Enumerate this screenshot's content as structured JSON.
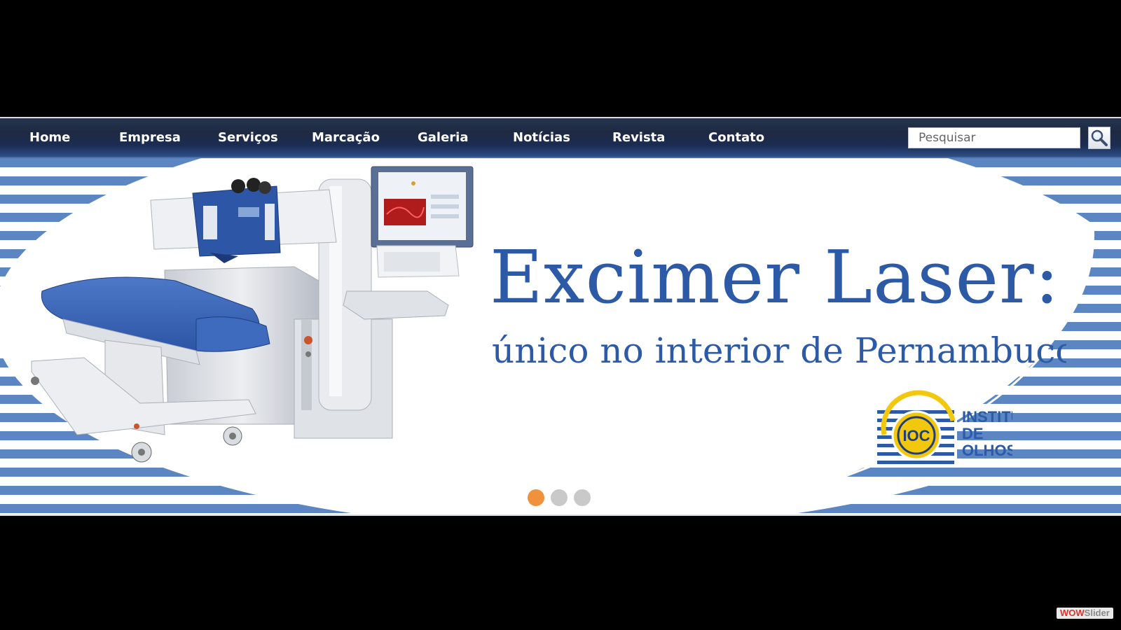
{
  "nav": {
    "items": [
      {
        "label": "Home",
        "active": true
      },
      {
        "label": "Empresa"
      },
      {
        "label": "Serviços"
      },
      {
        "label": "Marcação"
      },
      {
        "label": "Galeria"
      },
      {
        "label": "Notícias"
      },
      {
        "label": "Revista"
      },
      {
        "label": "Contato"
      }
    ]
  },
  "search": {
    "placeholder": "Pesquisar",
    "icon": "magnifier-icon"
  },
  "slide": {
    "headline": "Excimer Laser:",
    "subline": "único no interior de Pernambuco",
    "logo_mark": "IOC",
    "logo_text_line1": "INSTITUTO",
    "logo_text_line2": "DE OLHOS",
    "colors": {
      "brand_blue": "#2c5aa6",
      "stripe_blue": "#5b86c2",
      "logo_yellow": "#f2c80f"
    }
  },
  "slider_nav": {
    "dots": 3,
    "active_index": 0,
    "active_color": "#f0913c",
    "inactive_color": "#c9c9c9"
  },
  "watermark": {
    "part1": "WOW",
    "part2": "Slider"
  }
}
